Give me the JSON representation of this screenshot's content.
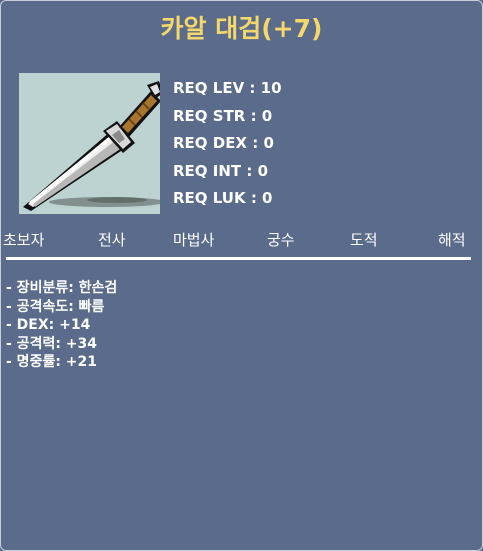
{
  "item": {
    "title": "카알 대검(+7)",
    "icon": "dagger-icon"
  },
  "requirements": [
    "REQ LEV : 10",
    "REQ STR : 0",
    "REQ DEX : 0",
    "REQ INT : 0",
    "REQ LUK : 0"
  ],
  "jobs": [
    "초보자",
    "전사",
    "마법사",
    "궁수",
    "도적",
    "해적"
  ],
  "stats": [
    "- 장비분류: 한손검",
    "- 공격속도: 빠름",
    "- DEX: +14",
    "- 공격력: +34",
    "- 명중률: +21"
  ],
  "colors": {
    "background": "#5a6b8c",
    "title": "#f5d76a",
    "icon_bg": "#bcd3d2",
    "text": "#ffffff"
  }
}
